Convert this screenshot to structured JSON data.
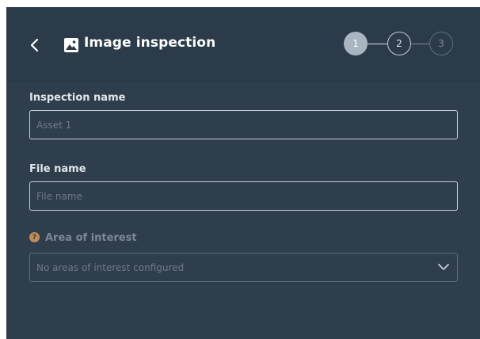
{
  "header": {
    "title": "Image inspection",
    "back_icon": "chevron-left-icon",
    "title_icon": "image-icon"
  },
  "stepper": {
    "steps": [
      {
        "label": "1",
        "state": "active"
      },
      {
        "label": "2",
        "state": "upcoming"
      },
      {
        "label": "3",
        "state": "disabled"
      }
    ]
  },
  "form": {
    "inspection_name": {
      "label": "Inspection name",
      "placeholder": "Asset 1",
      "value": ""
    },
    "file_name": {
      "label": "File name",
      "placeholder": "File name",
      "value": ""
    },
    "area_of_interest": {
      "label": "Area of interest",
      "help_icon": "help-icon",
      "selected": "No areas of interest configured",
      "disabled": true
    }
  },
  "colors": {
    "panel_bg": "#2f3e4d",
    "header_bg": "#2c3b49",
    "active_step": "#a9b5c0",
    "help_accent": "#c38a52"
  }
}
